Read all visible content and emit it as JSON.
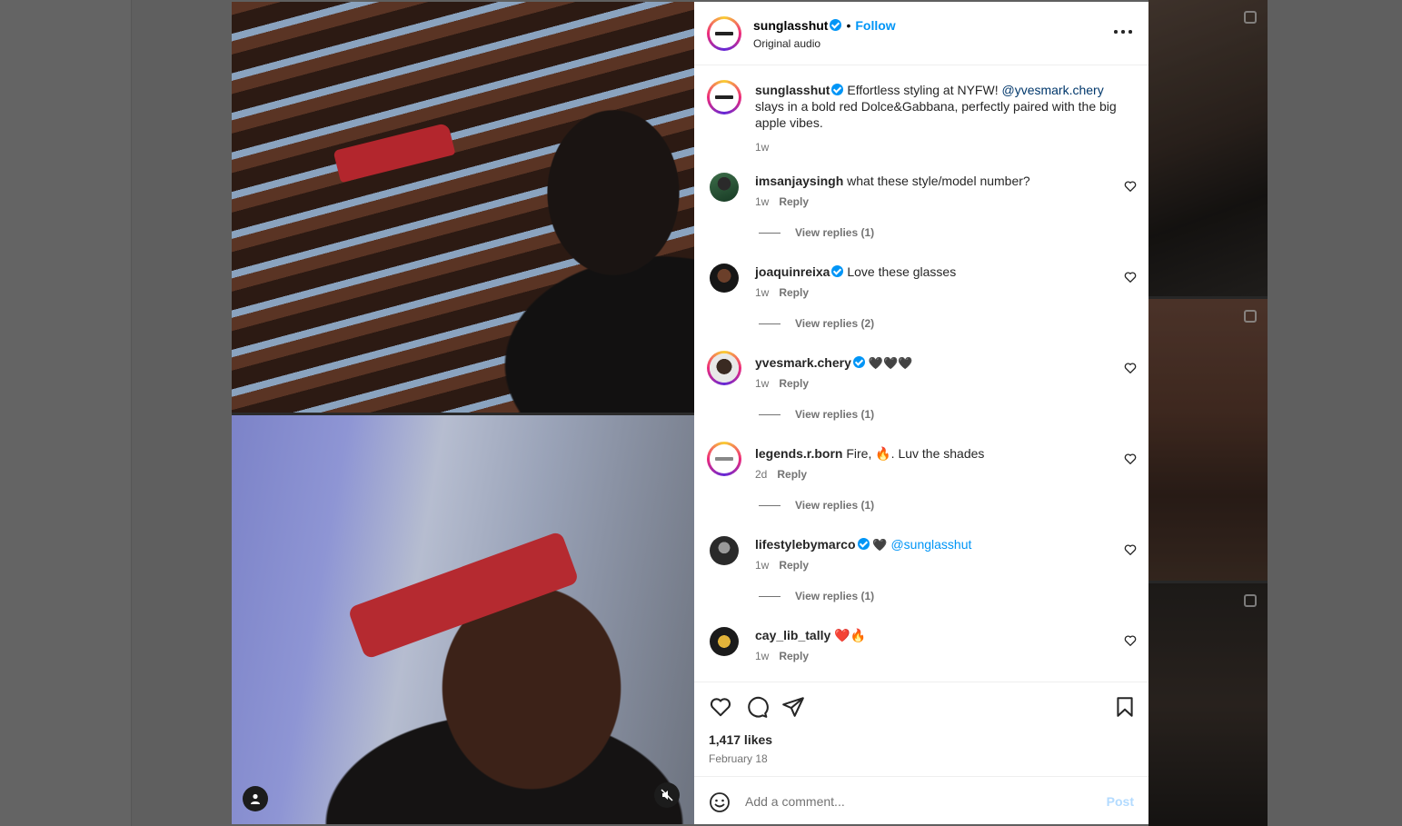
{
  "post": {
    "username": "sunglasshut",
    "follow_label": "Follow",
    "audio": "Original audio",
    "caption_prefix": "Effortless styling at NYFW! ",
    "caption_mention": "@yvesmark.chery",
    "caption_suffix": " slays in a bold red Dolce&Gabbana, perfectly paired with the big apple vibes.",
    "caption_time": "1w"
  },
  "comments": [
    {
      "username": "imsanjaysingh",
      "verified": false,
      "text": "what these style/model number?",
      "time": "1w",
      "reply_label": "Reply",
      "replies": "View replies (1)",
      "avatar_icon": "user-avatar-icon"
    },
    {
      "username": "joaquinreixa",
      "verified": true,
      "text": "Love these glasses",
      "time": "1w",
      "reply_label": "Reply",
      "replies": "View replies (2)",
      "avatar_icon": "user-avatar-icon"
    },
    {
      "username": "yvesmark.chery",
      "verified": true,
      "text": "🖤🖤🖤",
      "time": "1w",
      "reply_label": "Reply",
      "replies": "View replies (1)",
      "avatar_icon": "user-avatar-icon"
    },
    {
      "username": "legends.r.born",
      "verified": false,
      "text": "Fire, 🔥. Luv the shades",
      "time": "2d",
      "reply_label": "Reply",
      "replies": "View replies (1)",
      "avatar_icon": "user-avatar-icon"
    },
    {
      "username": "lifestylebymarco",
      "verified": true,
      "text": "🖤",
      "mention": "@sunglasshut",
      "time": "1w",
      "reply_label": "Reply",
      "replies": "View replies (1)",
      "avatar_icon": "user-avatar-icon"
    },
    {
      "username": "cay_lib_tally",
      "verified": false,
      "text": "❤️🔥",
      "time": "1w",
      "reply_label": "Reply",
      "replies": "",
      "avatar_icon": "user-avatar-icon"
    }
  ],
  "footer": {
    "likes": "1,417 likes",
    "date": "February 18",
    "comment_placeholder": "Add a comment...",
    "post_label": "Post"
  },
  "colors": {
    "accent": "#0095f6",
    "mention": "#00376b",
    "muted": "#737373"
  }
}
